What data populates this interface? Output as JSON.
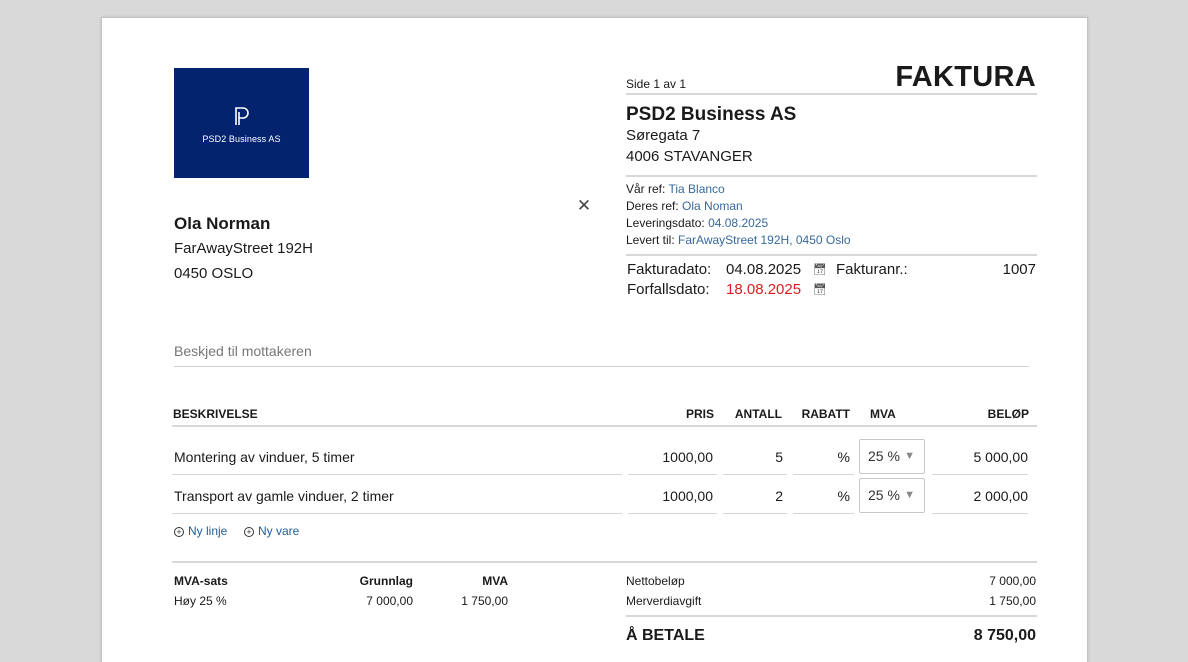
{
  "document": {
    "title": "FAKTURA",
    "page_indicator": "Side 1 av 1"
  },
  "logo": {
    "text": "PSD2 Business AS",
    "background_color": "#03236f"
  },
  "recipient": {
    "name": "Ola Norman",
    "street": "FarAwayStreet 192H",
    "postal": "0450 OSLO"
  },
  "sender": {
    "name": "PSD2 Business AS",
    "street": "Søregata 7",
    "postal": "4006 STAVANGER"
  },
  "references": {
    "our_ref_label": "Vår ref:",
    "our_ref": "Tia Blanco",
    "their_ref_label": "Deres ref:",
    "their_ref": "Ola Noman",
    "delivery_date_label": "Leveringsdato:",
    "delivery_date": "04.08.2025",
    "delivered_to_label": "Levert til:",
    "delivered_to": "FarAwayStreet 192H, 0450 Oslo",
    "link_color": "#37699b"
  },
  "dates": {
    "invoice_date_label": "Fakturadato:",
    "invoice_date": "04.08.2025",
    "due_date_label": "Forfallsdato:",
    "due_date": "18.08.2025",
    "due_date_color": "#d81e1e",
    "invoice_no_label": "Fakturanr.:",
    "invoice_no": "1007",
    "calendar_icon": "calendar-icon"
  },
  "message": {
    "placeholder": "Beskjed til mottakeren"
  },
  "table": {
    "headers": {
      "description": "BESKRIVELSE",
      "price": "PRIS",
      "quantity": "ANTALL",
      "discount": "RABATT",
      "vat": "MVA",
      "amount": "BELØP"
    },
    "rows": [
      {
        "description": "Montering av vinduer, 5 timer",
        "price": "1000,00",
        "quantity": "5",
        "discount": "%",
        "vat": "25 %",
        "amount": "5 000,00"
      },
      {
        "description": "Transport av gamle vinduer, 2 timer",
        "price": "1000,00",
        "quantity": "2",
        "discount": "%",
        "vat": "25 %",
        "amount": "2 000,00"
      }
    ]
  },
  "actions": {
    "new_line": "Ny linje",
    "new_item": "Ny vare"
  },
  "vat_summary": {
    "headers": {
      "rate": "MVA-sats",
      "base": "Grunnlag",
      "vat": "MVA"
    },
    "rows": [
      {
        "rate": "Høy 25 %",
        "base": "7 000,00",
        "vat": "1 750,00"
      }
    ]
  },
  "totals": {
    "net_label": "Nettobeløp",
    "net": "7 000,00",
    "vat_label": "Merverdiavgift",
    "vat": "1 750,00",
    "to_pay_label": "Å BETALE",
    "to_pay": "8 750,00"
  }
}
